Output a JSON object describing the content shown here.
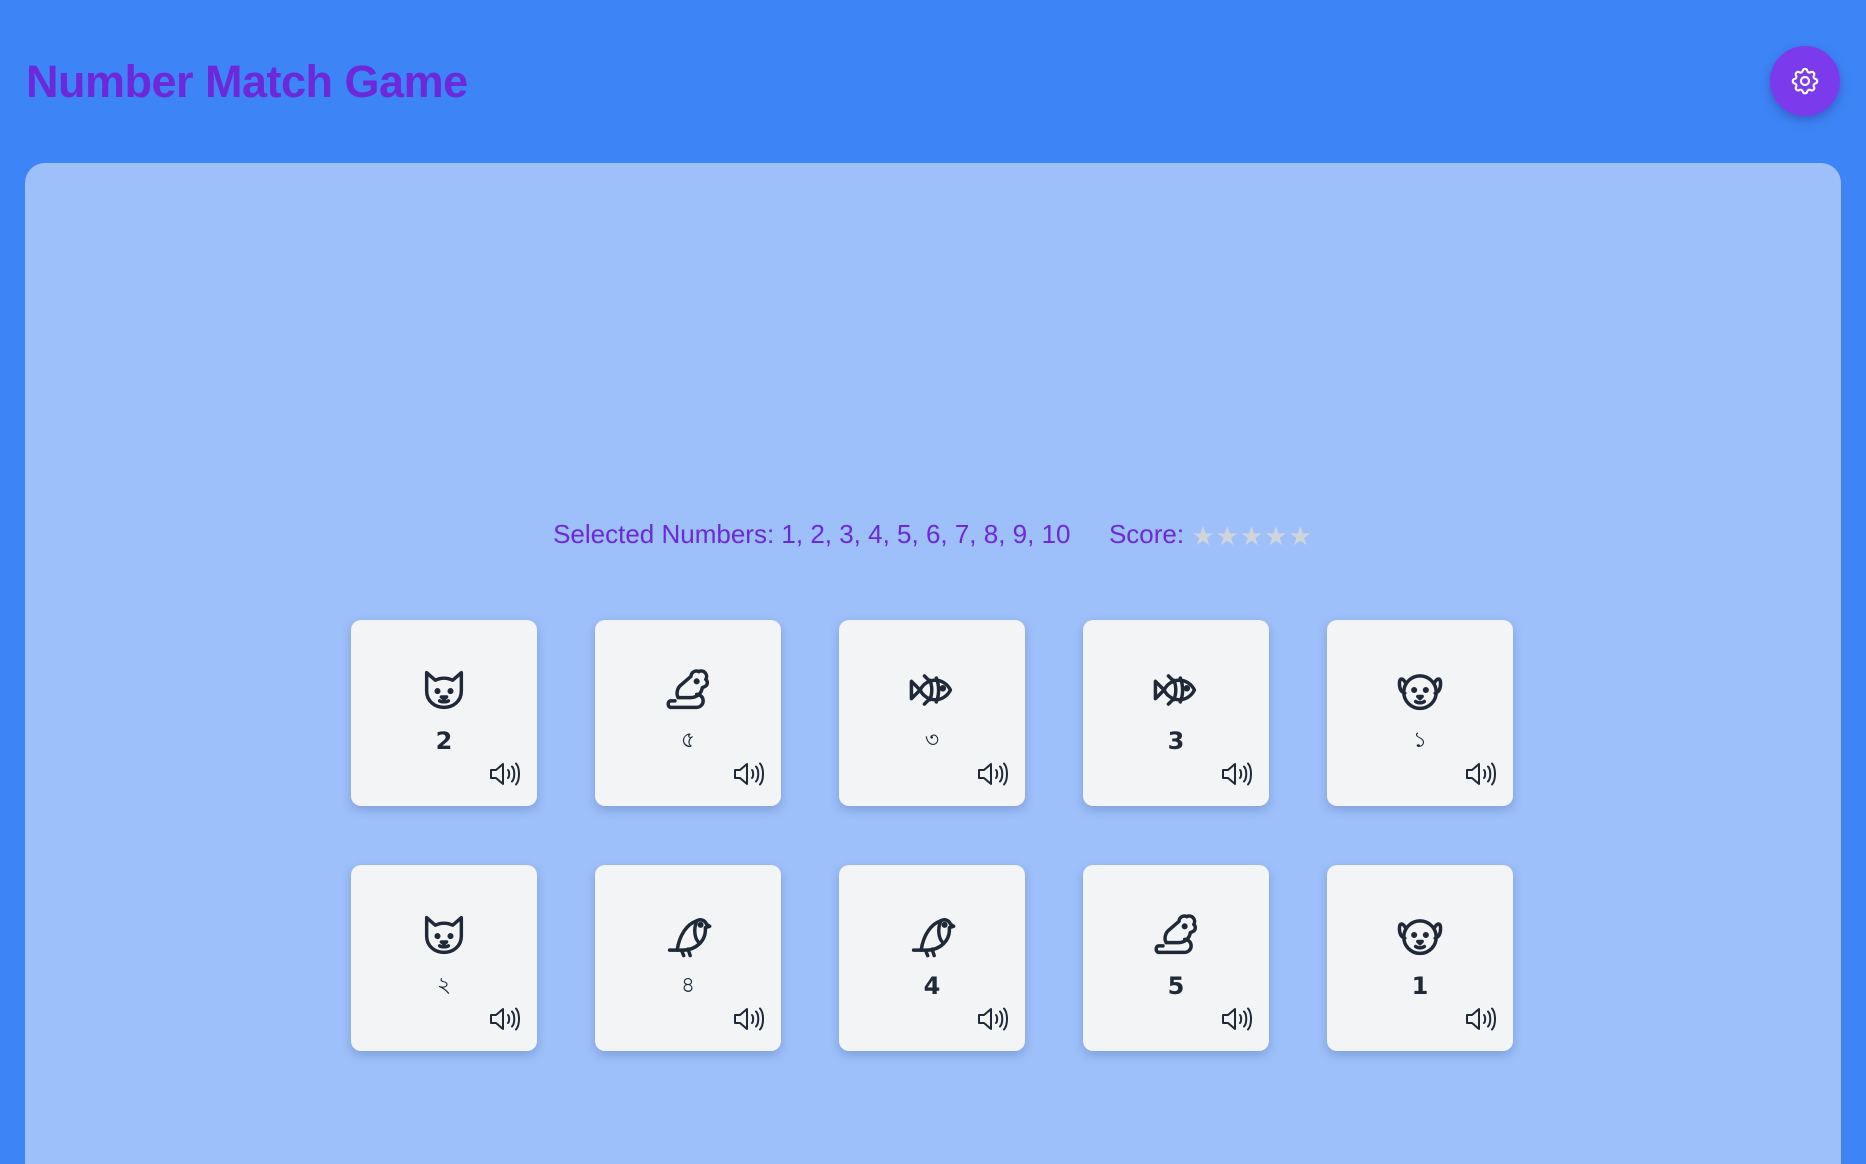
{
  "header": {
    "title": "Number Match Game",
    "settings_icon": "gear-icon"
  },
  "status": {
    "selected_label": "Selected Numbers:",
    "selected_numbers": "1, 2, 3, 4, 5, 6, 7, 8, 9, 10",
    "score_label": "Score:",
    "score_stars_filled": 0,
    "score_stars_total": 5
  },
  "cards": [
    {
      "animal": "cat-icon",
      "number": "2",
      "native": false
    },
    {
      "animal": "mouse-icon",
      "number": "৫",
      "native": true
    },
    {
      "animal": "fish-icon",
      "number": "৩",
      "native": true
    },
    {
      "animal": "fish-icon",
      "number": "3",
      "native": false
    },
    {
      "animal": "dog-icon",
      "number": "১",
      "native": true
    },
    {
      "animal": "cat-icon",
      "number": "২",
      "native": true
    },
    {
      "animal": "bird-icon",
      "number": "৪",
      "native": true
    },
    {
      "animal": "bird-icon",
      "number": "4",
      "native": false
    },
    {
      "animal": "mouse-icon",
      "number": "5",
      "native": false
    },
    {
      "animal": "dog-icon",
      "number": "1",
      "native": false
    }
  ],
  "colors": {
    "background": "#3d85f6",
    "panel": "#9ec0fa",
    "accent": "#6d28d9",
    "settings_button": "#7c3aed",
    "card": "#f3f4f6",
    "star_empty": "#d1d5db"
  }
}
